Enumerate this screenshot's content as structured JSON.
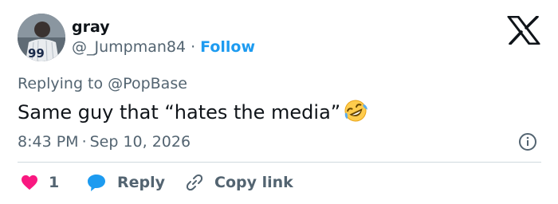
{
  "user": {
    "display_name": "gray",
    "handle": "@_Jumpman84",
    "separator": "·",
    "follow_label": "Follow",
    "avatar_jersey_number": "99"
  },
  "brand": {
    "logo_icon": "x-logo-icon"
  },
  "reply_context": {
    "prefix": "Replying to",
    "mention": "@PopBase"
  },
  "tweet": {
    "text": "Same guy that “hates the media”",
    "emoji": "rolling-on-floor-laughing"
  },
  "meta": {
    "time": "8:43 PM",
    "separator": "·",
    "date": "Sep 10, 2026",
    "info_icon": "info-icon"
  },
  "actions": {
    "like_count": "1",
    "reply_label": "Reply",
    "copy_link_label": "Copy link"
  },
  "colors": {
    "text_primary": "#0f1419",
    "text_secondary": "#536471",
    "link_blue": "#1d9bf0",
    "like_red": "#f91880",
    "divider": "#cfd9de"
  }
}
